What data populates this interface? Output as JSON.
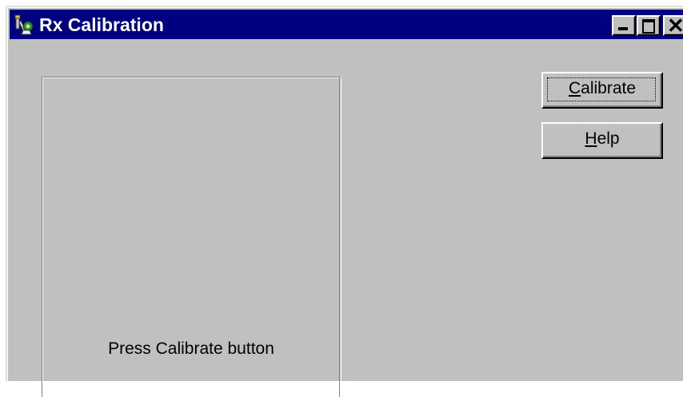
{
  "window": {
    "title": "Rx Calibration",
    "icon": "calibration-tools-icon",
    "controls": {
      "minimize": "minimize-icon",
      "maximize": "maximize-icon",
      "close": "close-icon"
    }
  },
  "panel": {
    "status_text": "Press Calibrate button"
  },
  "buttons": {
    "calibrate": {
      "mnemonic": "C",
      "rest": "alibrate"
    },
    "help": {
      "mnemonic": "H",
      "rest": "elp"
    }
  },
  "colors": {
    "titlebar": "#000080",
    "face": "#c0c0c0"
  }
}
